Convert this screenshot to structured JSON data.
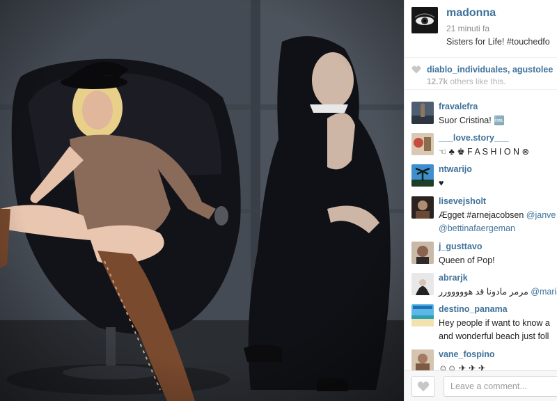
{
  "post": {
    "username": "madonna",
    "time_ago": "21 minuti fa",
    "caption": "Sisters for Life! #touchedfo"
  },
  "likes": {
    "user1": "diablo_individuales",
    "separator": ", ",
    "user2": "agustolee",
    "count": "12.7k",
    "count_suffix": " others like this."
  },
  "comments": [
    {
      "user": "fravalefra",
      "text": "Suor Cristina! 🆒"
    },
    {
      "user": "___love.story___",
      "text": "☜ ♣ ♚ F A S H I O N ⊗"
    },
    {
      "user": "ntwarijo",
      "text": "♥"
    },
    {
      "user": "lisevejsholt",
      "text_prefix": "Ægget #arnejacobsen ",
      "mention": "@janve",
      "text_line2": "@bettinafaergeman"
    },
    {
      "user": "j_gusttavo",
      "text": "Queen of Pop!"
    },
    {
      "user": "abrarjk",
      "text_prefix": "مرمر مادونا قد هووووورر ",
      "mention": "@mariam"
    },
    {
      "user": "destino_panama",
      "text": "Hey people if want to know a",
      "text_line2": "and wonderful beach just foll"
    },
    {
      "user": "vane_fospino",
      "text": "☺☺ ✈ ✈ ✈"
    }
  ],
  "footer": {
    "comment_placeholder": "Leave a comment..."
  },
  "colors": {
    "link": "#3f729b",
    "muted": "#8e8e8e",
    "heart": "#c7c7c7"
  },
  "icons": {
    "like_small": "heart-icon",
    "like_button": "heart-icon"
  }
}
